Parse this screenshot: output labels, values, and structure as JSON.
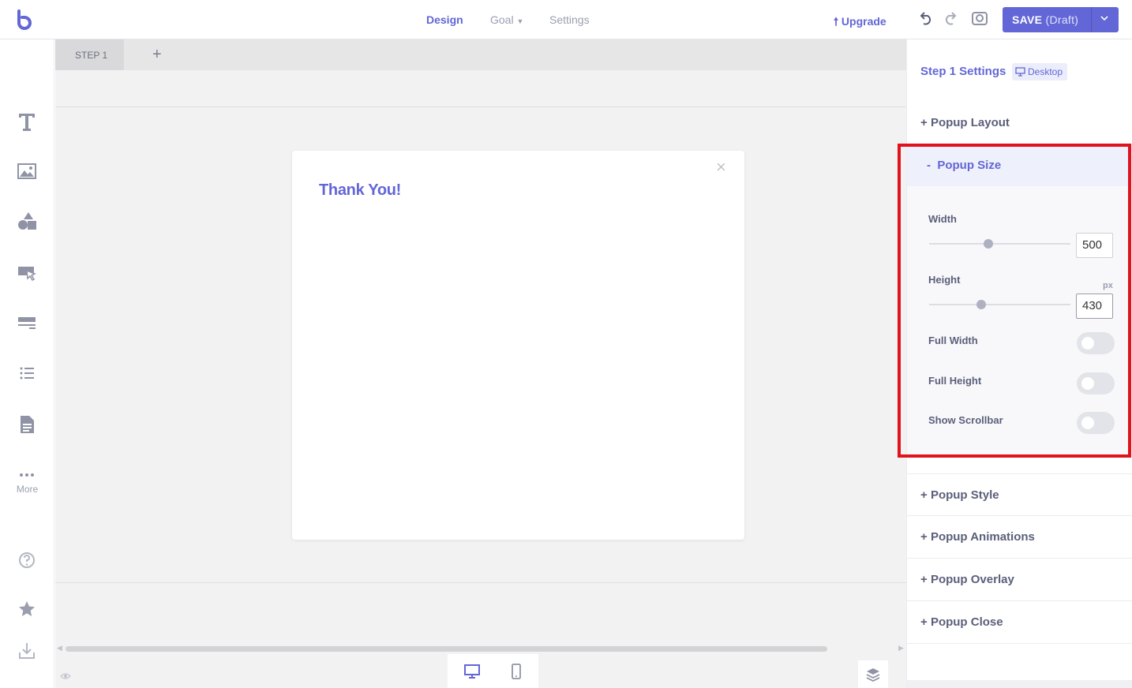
{
  "topbar": {
    "tabs": [
      {
        "label": "Design"
      },
      {
        "label": "Goal"
      },
      {
        "label": "Settings"
      }
    ],
    "upgrade_label": "Upgrade",
    "save_label": "SAVE",
    "save_status": "(Draft)"
  },
  "sidebar": {
    "tools": [
      "text-icon",
      "image-icon",
      "shapes-icon",
      "button-icon",
      "divider-icon",
      "list-icon",
      "form-icon",
      "more-icon"
    ],
    "more_label": "More"
  },
  "canvas": {
    "step_tab_label": "STEP 1",
    "add_step_label": "+",
    "popup_title": "Thank You!",
    "popup_close": "×"
  },
  "panel": {
    "title": "Step 1 Settings",
    "device_badge": "Desktop",
    "sections": {
      "layout": "Popup Layout",
      "size": "Popup Size",
      "style": "Popup Style",
      "animations": "Popup Animations",
      "overlay": "Popup Overlay",
      "close": "Popup Close"
    },
    "size": {
      "width_label": "Width",
      "width_value": "500",
      "width_slider_fraction": 0.42,
      "height_label": "Height",
      "height_value": "430",
      "height_slider_fraction": 0.37,
      "unit": "px",
      "full_width_label": "Full Width",
      "full_width_on": false,
      "full_height_label": "Full Height",
      "full_height_on": false,
      "show_scrollbar_label": "Show Scrollbar",
      "show_scrollbar_on": false
    }
  },
  "colors": {
    "accent": "#6266d6",
    "highlight": "#e0121b"
  }
}
